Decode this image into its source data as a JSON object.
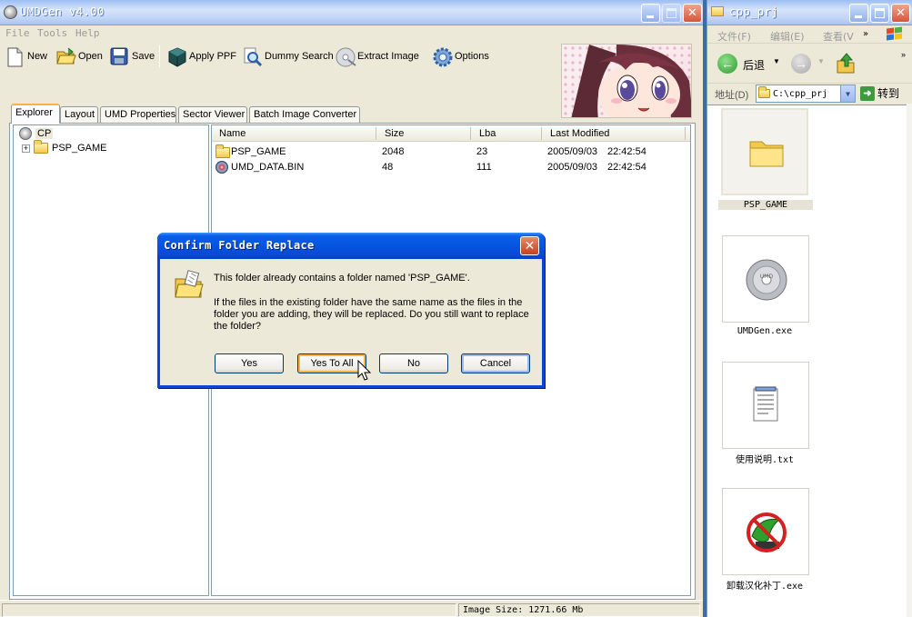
{
  "umdgen": {
    "title": "UMDGen v4.00",
    "menu": [
      "File",
      "Tools",
      "Help"
    ],
    "toolbar": {
      "new_label": "New",
      "open_label": "Open",
      "save_label": "Save",
      "apply_ppf_label": "Apply PPF",
      "dummy_search_label": "Dummy Search",
      "extract_image_label": "Extract Image",
      "options_label": "Options"
    },
    "tabs": [
      "Explorer",
      "Layout",
      "UMD Properties",
      "Sector Viewer",
      "Batch Image Converter"
    ],
    "tree": {
      "root": "CP",
      "child": "PSP_GAME"
    },
    "filelist": {
      "columns": [
        "Name",
        "Size",
        "Lba",
        "Last Modified"
      ],
      "rows": [
        {
          "name": "PSP_GAME",
          "size": "2048",
          "lba": "23",
          "date": "2005/09/03",
          "time": "22:42:54"
        },
        {
          "name": "UMD_DATA.BIN",
          "size": "48",
          "lba": "111",
          "date": "2005/09/03",
          "time": "22:42:54"
        }
      ]
    },
    "status": "Image Size: 1271.66 Mb"
  },
  "dialog": {
    "title": "Confirm Folder Replace",
    "line1": "This folder already contains a folder named 'PSP_GAME'.",
    "line2a": "If the files in the existing folder have the same name as the files in the",
    "line2b": "folder you are adding, they will be replaced. Do you still want to replace",
    "line2c": "the folder?",
    "buttons": {
      "yes": "Yes",
      "yes_to_all": "Yes To All",
      "no": "No",
      "cancel": "Cancel"
    }
  },
  "explorer": {
    "title": "cpp_prj",
    "menu": [
      "文件(F)",
      "编辑(E)",
      "查看(V"
    ],
    "back_label": "后退",
    "address_label": "地址(D)",
    "address_value": "C:\\cpp_prj",
    "go_label": "转到",
    "files": [
      "PSP_GAME",
      "UMDGen.exe",
      "使用说明.txt",
      "卸载汉化补丁.exe"
    ]
  }
}
